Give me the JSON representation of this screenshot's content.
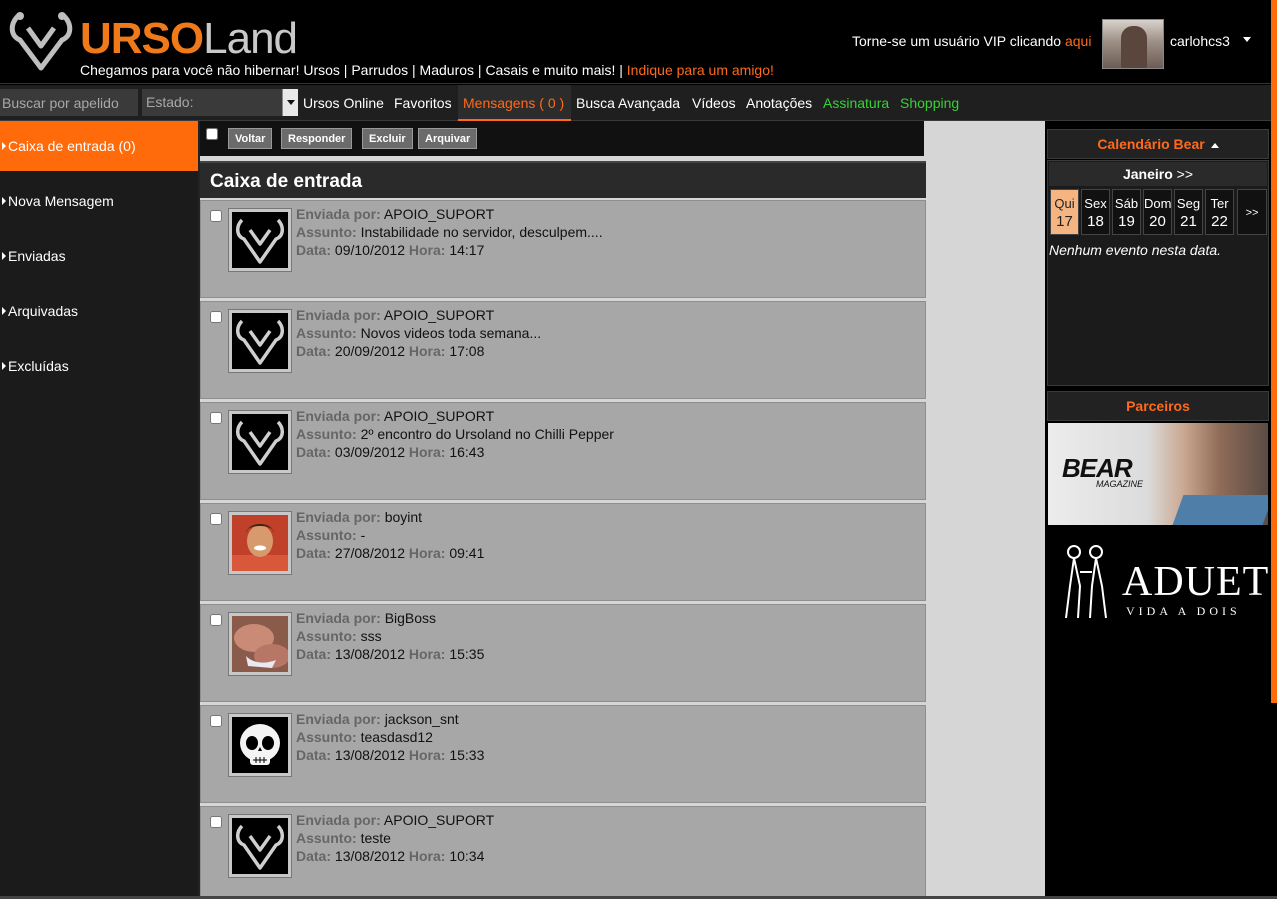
{
  "header": {
    "logo_urso": "URSO",
    "logo_land": "Land",
    "tagline": "Chegamos para você não hibernar! Ursos | Parrudos | Maduros | Casais e muito mais! | ",
    "tagline_link": "Indique para um amigo!",
    "vip_text": "Torne-se um usuário VIP clicando ",
    "vip_link": "aqui",
    "username": "carlohcs3"
  },
  "nav": {
    "search_placeholder": "Buscar por apelido",
    "state_label": "Estado:",
    "links": [
      "Ursos Online",
      "Favoritos",
      "Mensagens ( 0 )",
      "Busca Avançada",
      "Vídeos",
      "Anotações",
      "Assinatura",
      "Shopping"
    ]
  },
  "sidebar": {
    "items": [
      "Caixa de entrada (0)",
      "Nova Mensagem",
      "Enviadas",
      "Arquivadas",
      "Excluídas"
    ]
  },
  "toolbar": {
    "buttons": [
      "Voltar",
      "Responder",
      "Excluir",
      "Arquivar"
    ]
  },
  "inbox": {
    "title": "Caixa de entrada",
    "labels": {
      "from": "Enviada por:",
      "subject": "Assunto:",
      "date": "Data:",
      "time": "Hora:"
    },
    "messages": [
      {
        "from": "APOIO_SUPORT",
        "subject": "Instabilidade no servidor, desculpem....",
        "date": "09/10/2012",
        "time": "14:17",
        "avatar": "ursoland-logo-icon"
      },
      {
        "from": "APOIO_SUPORT",
        "subject": "Novos videos toda semana...",
        "date": "20/09/2012",
        "time": "17:08",
        "avatar": "ursoland-logo-icon"
      },
      {
        "from": "APOIO_SUPORT",
        "subject": "2º encontro do Ursoland no Chilli Pepper",
        "date": "03/09/2012",
        "time": "16:43",
        "avatar": "ursoland-logo-icon"
      },
      {
        "from": "boyint",
        "subject": "-",
        "date": "27/08/2012",
        "time": "09:41",
        "avatar": "user-photo"
      },
      {
        "from": "BigBoss",
        "subject": "sss",
        "date": "13/08/2012",
        "time": "15:35",
        "avatar": "user-photo"
      },
      {
        "from": "jackson_snt",
        "subject": "teasdasd12",
        "date": "13/08/2012",
        "time": "15:33",
        "avatar": "skull-icon"
      },
      {
        "from": "APOIO_SUPORT",
        "subject": "teste",
        "date": "13/08/2012",
        "time": "10:34",
        "avatar": "ursoland-logo-icon"
      }
    ]
  },
  "calendar": {
    "title": "Calendário Bear",
    "month": "Janeiro",
    "month_next": ">>",
    "days": [
      {
        "name": "Qui",
        "num": "17",
        "selected": true
      },
      {
        "name": "Sex",
        "num": "18"
      },
      {
        "name": "Sáb",
        "num": "19"
      },
      {
        "name": "Dom",
        "num": "20"
      },
      {
        "name": "Seg",
        "num": "21"
      },
      {
        "name": "Ter",
        "num": "22"
      }
    ],
    "days_next": ">>",
    "no_event": "Nenhum evento nesta data."
  },
  "partners": {
    "title": "Parceiros",
    "bear_ad": {
      "title": "BEAR",
      "sub": "MAGAZINE"
    },
    "aduet_ad": {
      "title": "ADUET",
      "sub": "VIDA A DOIS"
    }
  },
  "colors": {
    "accent": "#ff6a1a",
    "green": "#37d137",
    "panel": "#1b1b1b",
    "message_bg": "#a7a7a7"
  }
}
